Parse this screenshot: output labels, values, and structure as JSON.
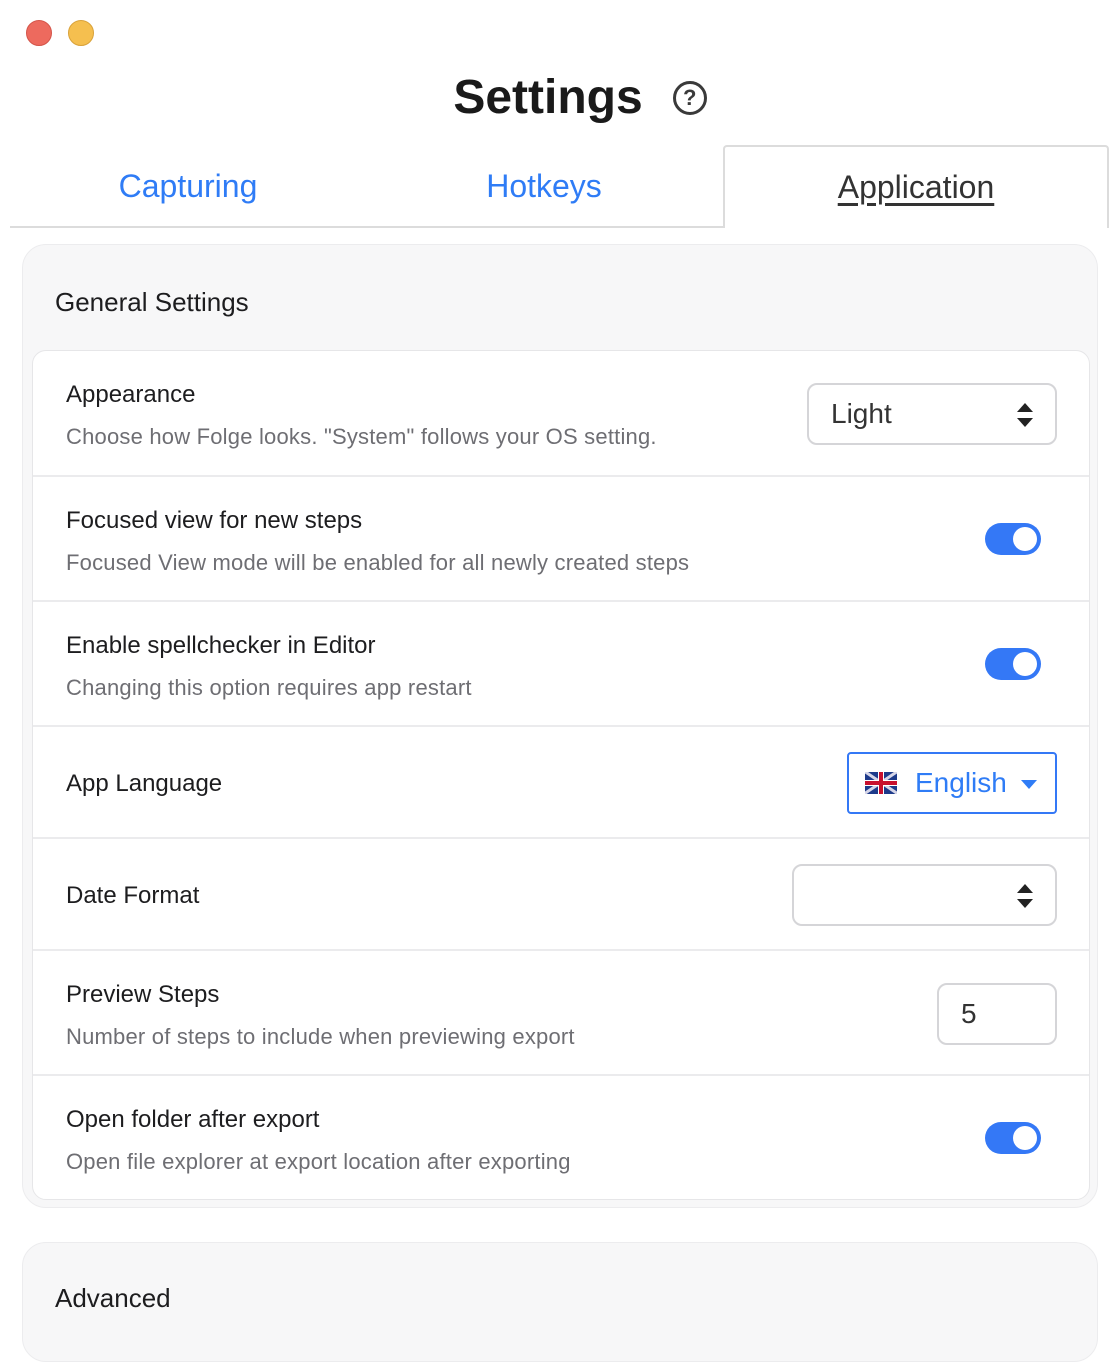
{
  "window": {
    "title": "Settings"
  },
  "tabs": [
    {
      "label": "Capturing"
    },
    {
      "label": "Hotkeys"
    },
    {
      "label": "Application"
    }
  ],
  "sections": {
    "general": {
      "title": "General Settings"
    },
    "advanced": {
      "title": "Advanced"
    }
  },
  "settings": {
    "appearance": {
      "label": "Appearance",
      "description": "Choose how Folge looks. \"System\" follows your OS setting.",
      "value": "Light"
    },
    "focused_view": {
      "label": "Focused view for new steps",
      "description": "Focused View mode will be enabled for all newly created steps",
      "enabled": true
    },
    "spellchecker": {
      "label": "Enable spellchecker in Editor",
      "description": "Changing this option requires app restart",
      "enabled": true
    },
    "language": {
      "label": "App Language",
      "value": "English"
    },
    "date_format": {
      "label": "Date Format",
      "value": ""
    },
    "preview_steps": {
      "label": "Preview Steps",
      "description": "Number of steps to include when previewing export",
      "value": "5"
    },
    "open_folder": {
      "label": "Open folder after export",
      "description": "Open file explorer at export location after exporting",
      "enabled": true
    }
  },
  "colors": {
    "accent": "#3478f6",
    "tab_link": "#2f7cf6",
    "toggle_on": "#3478f6"
  },
  "icons": {
    "help": "question-circle-icon",
    "select": "up-down-arrows-icon",
    "dropdown": "caret-down-icon",
    "flag": "uk-flag-icon"
  }
}
